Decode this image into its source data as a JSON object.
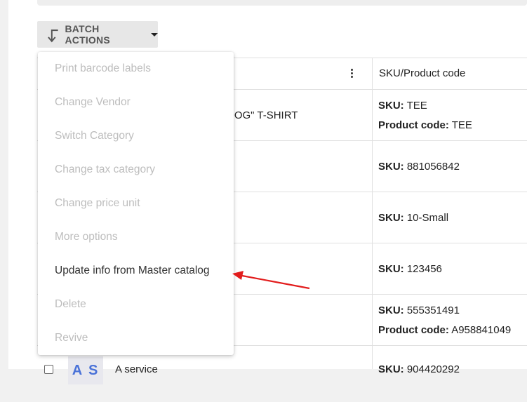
{
  "toolbar": {
    "batch_actions_label": "BATCH ACTIONS"
  },
  "batch_menu": {
    "items": [
      {
        "label": "Print barcode labels",
        "enabled": false
      },
      {
        "label": "Change Vendor",
        "enabled": false
      },
      {
        "label": "Switch Category",
        "enabled": false
      },
      {
        "label": "Change tax category",
        "enabled": false
      },
      {
        "label": "Change price unit",
        "enabled": false
      },
      {
        "label": "More options",
        "enabled": false
      },
      {
        "label": "Update info from Master catalog",
        "enabled": true
      },
      {
        "label": "Delete",
        "enabled": false
      },
      {
        "label": "Revive",
        "enabled": false
      }
    ]
  },
  "table": {
    "header": {
      "sku_column": "SKU/Product code"
    },
    "rows": [
      {
        "name": "DOG\" T-SHIRT",
        "sku_label": "SKU:",
        "sku": "TEE",
        "product_code_label": "Product code:",
        "product_code": "TEE"
      },
      {
        "sku_label": "SKU:",
        "sku": "881056842"
      },
      {
        "sku_label": "SKU:",
        "sku": "10-Small"
      },
      {
        "sku_label": "SKU:",
        "sku": "123456"
      },
      {
        "sku_label": "SKU:",
        "sku": "555351491",
        "product_code_label": "Product code:",
        "product_code": "A958841049"
      },
      {
        "thumb_text": "A S",
        "name": "A service",
        "sku_label": "SKU:",
        "sku": "904420292"
      }
    ]
  },
  "annotation": {
    "arrow_color": "#e21c1c"
  }
}
